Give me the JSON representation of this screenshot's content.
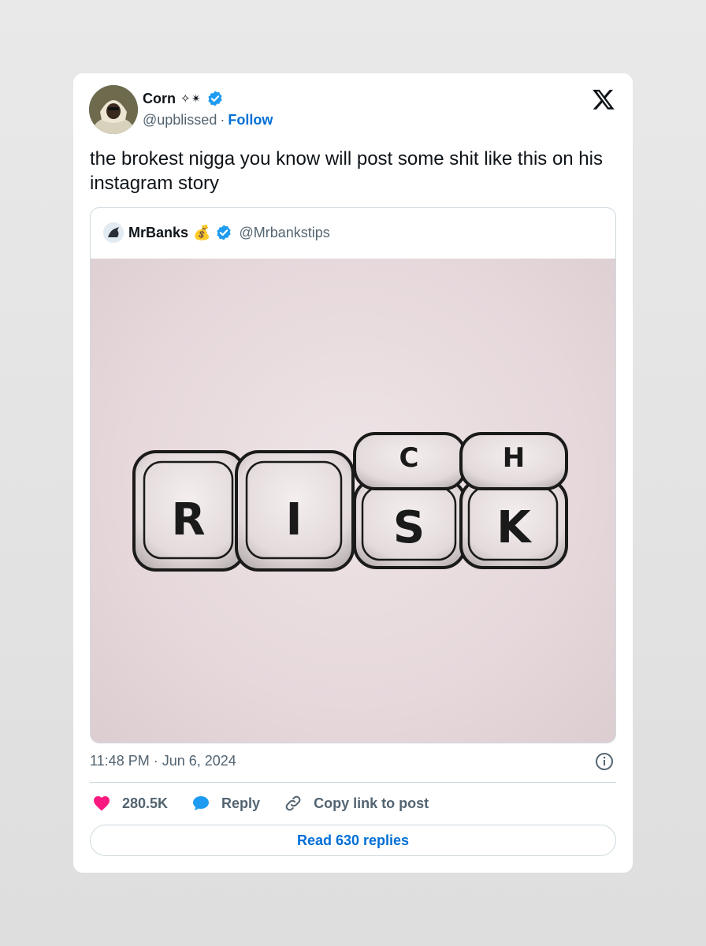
{
  "author": {
    "name": "Corn",
    "name_emblem": "✧✴︎",
    "handle": "@upblissed",
    "separator": "·",
    "follow_label": "Follow"
  },
  "tweet": {
    "text": "the brokest nigga you know will post some shit like this on his instagram story"
  },
  "quoted": {
    "name": "MrBanks",
    "name_emoji": "💰",
    "handle": "@Mrbankstips",
    "image": {
      "tile_letters_bottom": [
        "R",
        "I",
        "S",
        "K"
      ],
      "tile_letters_top": [
        "C",
        "H"
      ]
    }
  },
  "meta": {
    "timestamp": "11:48 PM · Jun 6, 2024"
  },
  "actions": {
    "likes": "280.5K",
    "reply_label": "Reply",
    "copy_label": "Copy link to post"
  },
  "read_replies_label": "Read 630 replies",
  "colors": {
    "accent": "#006fd6",
    "verified": "#1d9bf0",
    "like": "#f91880",
    "reply_icon": "#1d9bf0"
  },
  "icons": {
    "platform": "x-logo-icon",
    "verified": "verified-badge-icon",
    "info": "info-icon",
    "like": "heart-icon",
    "reply": "speech-bubble-icon",
    "copy": "link-icon"
  }
}
